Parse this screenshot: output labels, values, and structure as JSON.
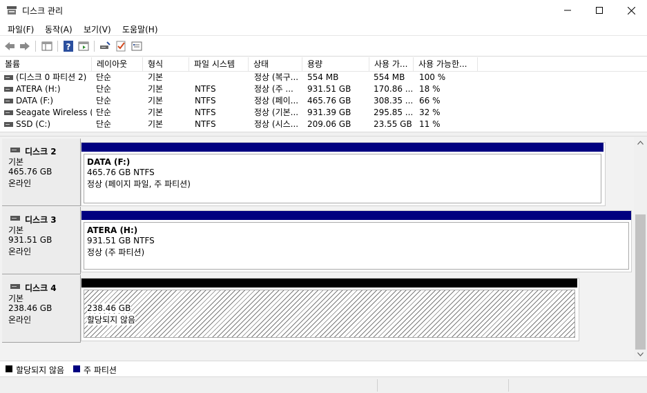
{
  "window": {
    "title": "디스크 관리",
    "icons": {
      "app": "disk-management-icon",
      "minimize": "minimize-icon",
      "maximize": "maximize-icon",
      "close": "close-icon"
    }
  },
  "menu": {
    "items": [
      "파일(F)",
      "동작(A)",
      "보기(V)",
      "도움말(H)"
    ]
  },
  "toolbar": {
    "icons": [
      "back-arrow-icon",
      "forward-arrow-icon",
      "console-tree-icon",
      "help-icon",
      "action-pane-icon",
      "connect-disk-icon",
      "check-icon",
      "properties-icon"
    ]
  },
  "volumes": {
    "columns": [
      "볼륨",
      "레이아웃",
      "형식",
      "파일 시스템",
      "상태",
      "용량",
      "사용 가...",
      "사용 가능한..."
    ],
    "rows": [
      [
        "(디스크 0 파티션 2)",
        "단순",
        "기본",
        "",
        "정상 (복구...",
        "554 MB",
        "554 MB",
        "100 %"
      ],
      [
        "ATERA (H:)",
        "단순",
        "기본",
        "NTFS",
        "정상 (주 ...",
        "931.51 GB",
        "170.86 ...",
        "18 %"
      ],
      [
        "DATA (F:)",
        "단순",
        "기본",
        "NTFS",
        "정상 (페이...",
        "465.76 GB",
        "308.35 ...",
        "66 %"
      ],
      [
        "Seagate Wireless (...",
        "단순",
        "기본",
        "NTFS",
        "정상 (기본...",
        "931.39 GB",
        "295.85 ...",
        "32 %"
      ],
      [
        "SSD (C:)",
        "단순",
        "기본",
        "NTFS",
        "정상 (시스...",
        "209.06 GB",
        "23.55 GB",
        "11 %"
      ]
    ]
  },
  "disks": [
    {
      "name": "디스크 2",
      "type": "기본",
      "size": "465.76 GB",
      "status": "온라인",
      "partition": {
        "name": "DATA  (F:)",
        "size_fs": "465.76 GB NTFS",
        "status": "정상 (페이지 파일, 주 파티션)",
        "bar_color": "#000080"
      }
    },
    {
      "name": "디스크 3",
      "type": "기본",
      "size": "931.51 GB",
      "status": "온라인",
      "partition": {
        "name": "ATERA  (H:)",
        "size_fs": "931.51 GB NTFS",
        "status": "정상 (주 파티션)",
        "bar_color": "#000080"
      }
    },
    {
      "name": "디스크 4",
      "type": "기본",
      "size": "238.46 GB",
      "status": "온라인",
      "partition": {
        "name": "",
        "size_fs": "238.46 GB",
        "status": "할당되지 않음",
        "bar_color": "#000000"
      }
    }
  ],
  "legend": [
    {
      "label": "할당되지 않음",
      "color": "#000000"
    },
    {
      "label": "주 파티션",
      "color": "#000080"
    }
  ]
}
